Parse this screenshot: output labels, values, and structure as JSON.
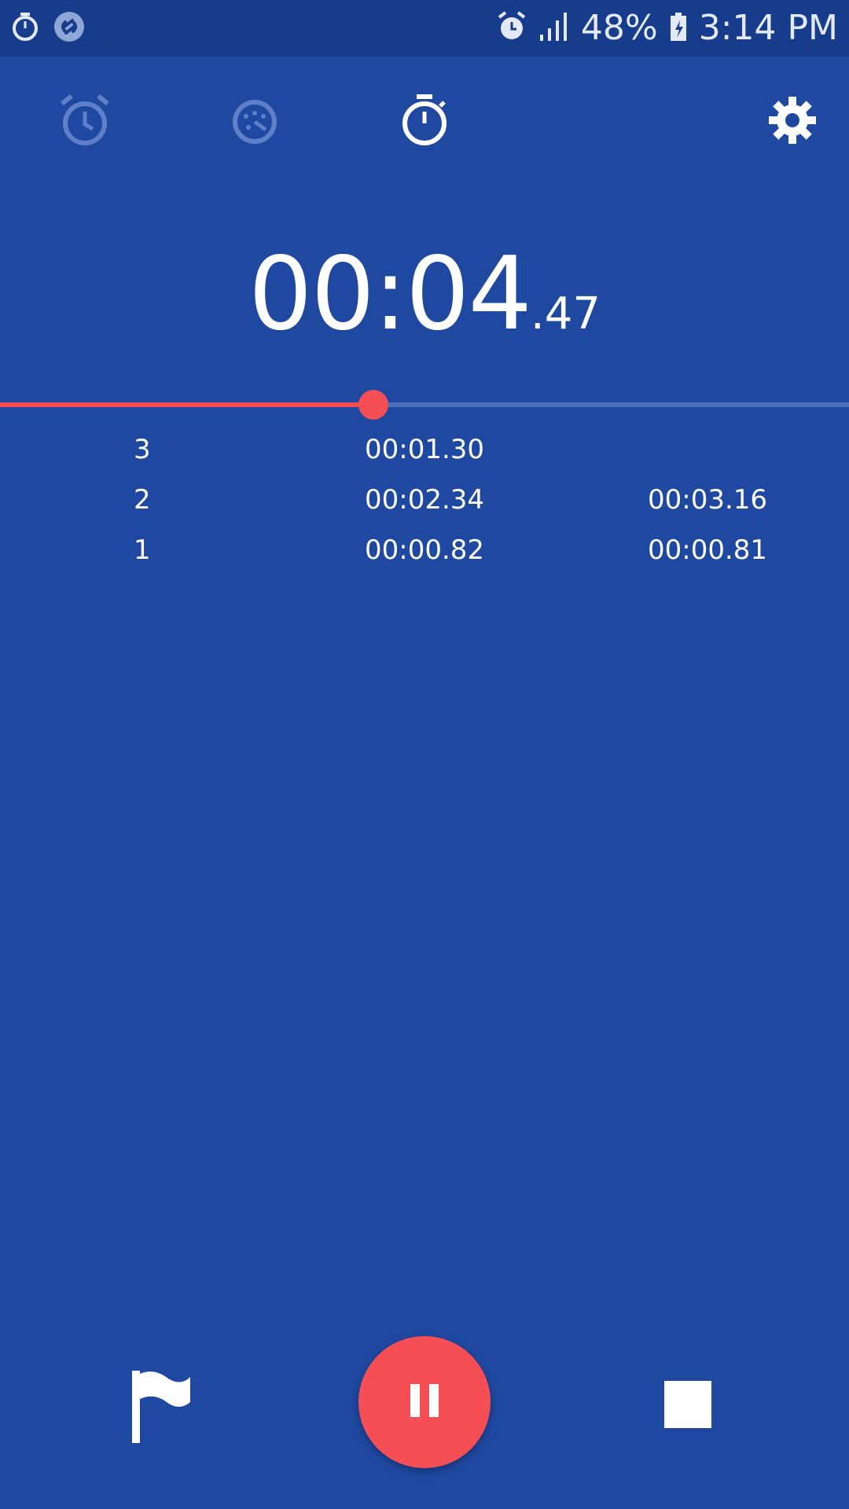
{
  "status_bar": {
    "battery_percent": "48%",
    "time": "3:14 PM",
    "icons": [
      "stopwatch-icon",
      "shazam-icon",
      "alarm-icon",
      "signal-icon",
      "battery-icon"
    ]
  },
  "tabs": [
    {
      "name": "alarm",
      "icon": "alarm-icon",
      "active": false
    },
    {
      "name": "world-clock",
      "icon": "world-clock-icon",
      "active": false
    },
    {
      "name": "stopwatch",
      "icon": "stopwatch-icon",
      "active": true
    }
  ],
  "settings_icon": "gear-icon",
  "timer": {
    "main": "00:04",
    "fraction": ".47"
  },
  "progress": {
    "fraction": 0.44,
    "colors": {
      "fill": "#f34f55",
      "track": "#4b6fb7"
    }
  },
  "laps": [
    {
      "number": "3",
      "lap_time": "00:01.30",
      "total": ""
    },
    {
      "number": "2",
      "lap_time": "00:02.34",
      "total": "00:03.16"
    },
    {
      "number": "1",
      "lap_time": "00:00.82",
      "total": "00:00.81"
    }
  ],
  "controls": {
    "lap_icon": "flag-icon",
    "pause_icon": "pause-icon",
    "stop_icon": "stop-icon"
  },
  "colors": {
    "background": "#1f48a0",
    "status_bar": "#173c8c",
    "accent": "#f54f55"
  }
}
